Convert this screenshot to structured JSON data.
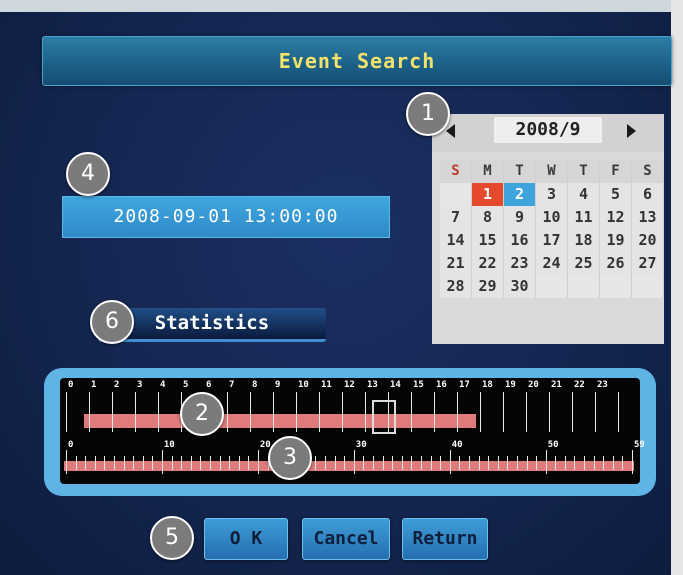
{
  "title": "Event Search",
  "calendar": {
    "month_label": "2008/9",
    "weekdays": [
      "S",
      "M",
      "T",
      "W",
      "T",
      "F",
      "S"
    ],
    "weeks": [
      [
        "",
        "1",
        "2",
        "3",
        "4",
        "5",
        "6"
      ],
      [
        "7",
        "8",
        "9",
        "10",
        "11",
        "12",
        "13"
      ],
      [
        "14",
        "15",
        "16",
        "17",
        "18",
        "19",
        "20"
      ],
      [
        "21",
        "22",
        "23",
        "24",
        "25",
        "26",
        "27"
      ],
      [
        "28",
        "29",
        "30",
        "",
        "",
        "",
        ""
      ]
    ],
    "highlight_red": "1",
    "highlight_blue": "2"
  },
  "datetime_value": "2008-09-01 13:00:00",
  "statistics_label": "Statistics",
  "timeline": {
    "hour_labels": [
      "0",
      "1",
      "2",
      "3",
      "4",
      "5",
      "6",
      "7",
      "8",
      "9",
      "10",
      "11",
      "12",
      "13",
      "14",
      "15",
      "16",
      "17",
      "18",
      "19",
      "20",
      "21",
      "22",
      "23"
    ],
    "minute_labels": [
      "0",
      "10",
      "20",
      "30",
      "40",
      "50",
      "59"
    ]
  },
  "buttons": {
    "ok": "O K",
    "cancel": "Cancel",
    "return": "Return"
  },
  "badges": {
    "b1": "1",
    "b2": "2",
    "b3": "3",
    "b4": "4",
    "b5": "5",
    "b6": "6"
  },
  "colors": {
    "title_text": "#f3e26a",
    "highlight_red": "#e44a2b",
    "highlight_blue": "#3da4dc",
    "bar": "#e07b7b"
  }
}
